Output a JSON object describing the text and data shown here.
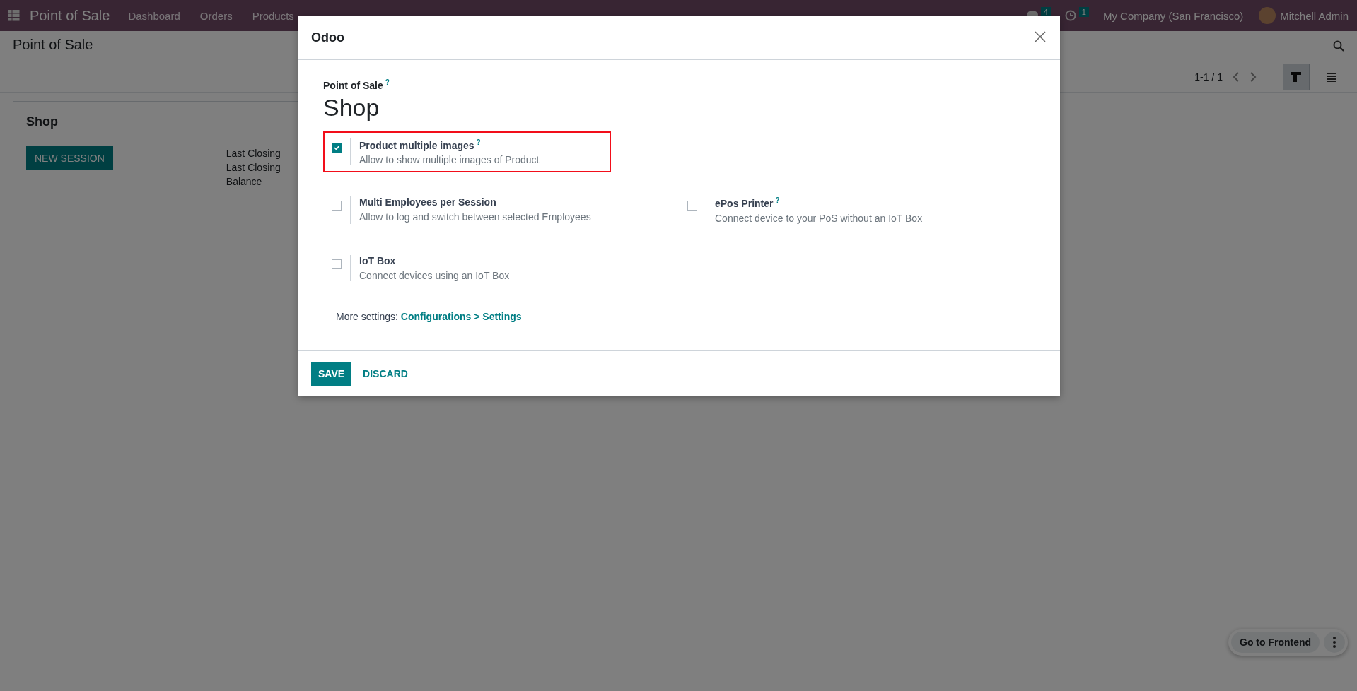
{
  "navbar": {
    "app_name": "Point of Sale",
    "menu": [
      "Dashboard",
      "Orders",
      "Products"
    ],
    "messages_badge": "4",
    "activities_badge": "1",
    "company": "My Company (San Francisco)",
    "user": "Mitchell Admin"
  },
  "control_panel": {
    "title": "Point of Sale",
    "pager": "1-1 / 1",
    "views": [
      {
        "kind": "kanban",
        "selected": true
      },
      {
        "kind": "list",
        "selected": false
      }
    ]
  },
  "card": {
    "title": "Shop",
    "button": "NEW SESSION",
    "lines": [
      "Last Closing",
      "Last Closing",
      "Balance"
    ]
  },
  "dialog": {
    "title": "Odoo",
    "field_label": "Point of Sale",
    "field_help": true,
    "record_name": "Shop",
    "rows": [
      [
        {
          "title": "Product multiple images",
          "help": true,
          "description": "Allow to show multiple images of Product",
          "checked": true,
          "highlighted": true
        }
      ],
      [
        {
          "title": "Multi Employees per Session",
          "help": false,
          "description": "Allow to log and switch between selected Employees",
          "checked": false,
          "highlighted": false
        },
        {
          "title": "ePos Printer",
          "help": true,
          "description": "Connect device to your PoS without an IoT Box",
          "checked": false,
          "highlighted": false
        }
      ],
      [
        {
          "title": "IoT Box",
          "help": false,
          "description": "Connect devices using an IoT Box",
          "checked": false,
          "highlighted": false
        }
      ]
    ],
    "more_label": "More settings:",
    "more_link": "Configurations > Settings",
    "buttons": [
      "SAVE",
      "DISCARD"
    ]
  },
  "help_mark": "?",
  "frontend_button": "Go to Frontend"
}
